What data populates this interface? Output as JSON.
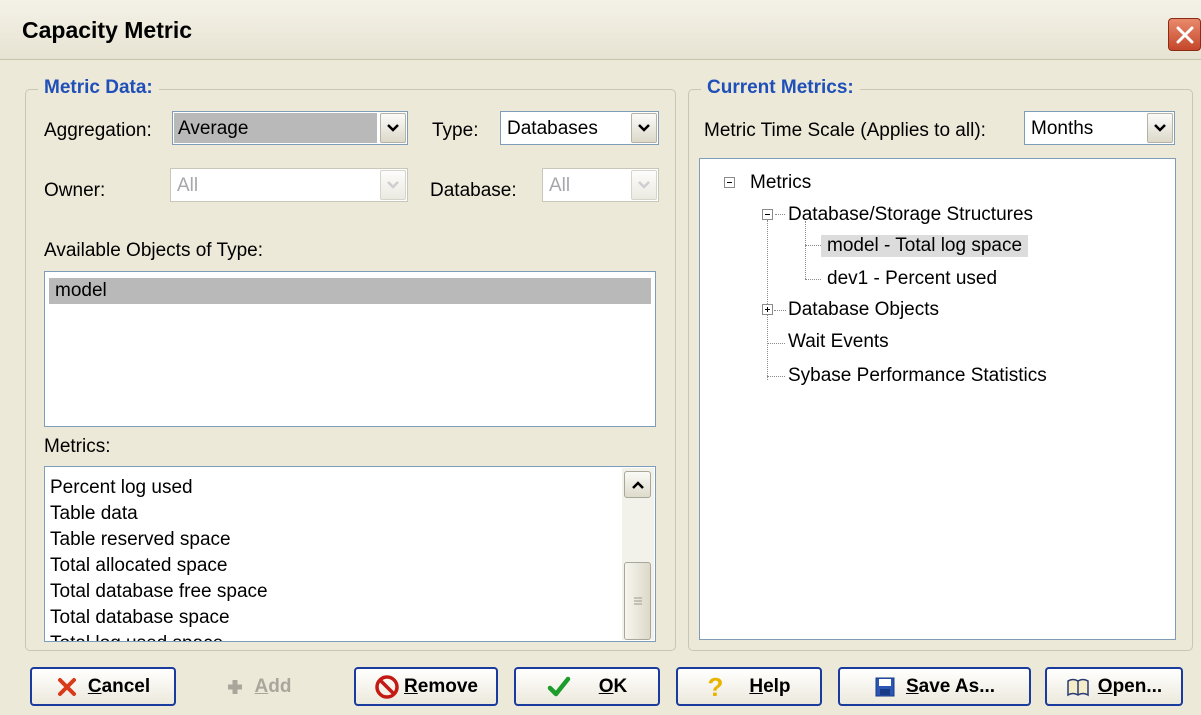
{
  "window": {
    "title": "Capacity Metric"
  },
  "colors": {
    "legend": "#1f4fb8",
    "button_border": "#1a3b9e",
    "selection": "#b9b9b9",
    "dialog_bg": "#ece9d8"
  },
  "metric_data": {
    "legend": "Metric Data:",
    "aggregation_label": "Aggregation:",
    "aggregation_value": "Average",
    "type_label": "Type:",
    "type_value": "Databases",
    "owner_label": "Owner:",
    "owner_value": "All",
    "database_label": "Database:",
    "database_value": "All",
    "available_label": "Available Objects of Type:",
    "available_objects": [
      "model"
    ],
    "metrics_label": "Metrics:",
    "metrics": [
      "Percent log used",
      "Table data",
      "Table reserved space",
      "Total allocated space",
      "Total database free space",
      "Total database space",
      "Total log used space"
    ]
  },
  "current_metrics": {
    "legend": "Current Metrics:",
    "timescale_label": "Metric Time Scale (Applies to all):",
    "timescale_value": "Months",
    "tree": {
      "root": "Metrics",
      "db_storage": "Database/Storage Structures",
      "leaf_model": "model - Total log space",
      "leaf_dev1": "dev1 - Percent used",
      "db_objects": "Database Objects",
      "wait_events": "Wait Events",
      "sybase_stats": "Sybase Performance Statistics"
    }
  },
  "buttons": {
    "cancel": {
      "mnemonic": "C",
      "rest": "ancel"
    },
    "add": {
      "mnemonic": "A",
      "rest": "dd"
    },
    "remove": {
      "mnemonic": "R",
      "rest": "emove"
    },
    "ok": {
      "mnemonic": "O",
      "rest": "K"
    },
    "help": {
      "mnemonic": "H",
      "rest": "elp"
    },
    "save_as": {
      "mnemonic": "S",
      "rest": "ave As..."
    },
    "open": {
      "mnemonic": "O",
      "rest": "pen..."
    }
  },
  "icons": {
    "close": "close-icon",
    "dropdown": "chevron-down-icon",
    "cancel": "x-icon",
    "add": "plus-icon",
    "remove": "prohibited-icon",
    "ok": "checkmark-icon",
    "help": "question-mark-icon",
    "save_as": "floppy-disk-icon",
    "open": "open-book-icon"
  }
}
